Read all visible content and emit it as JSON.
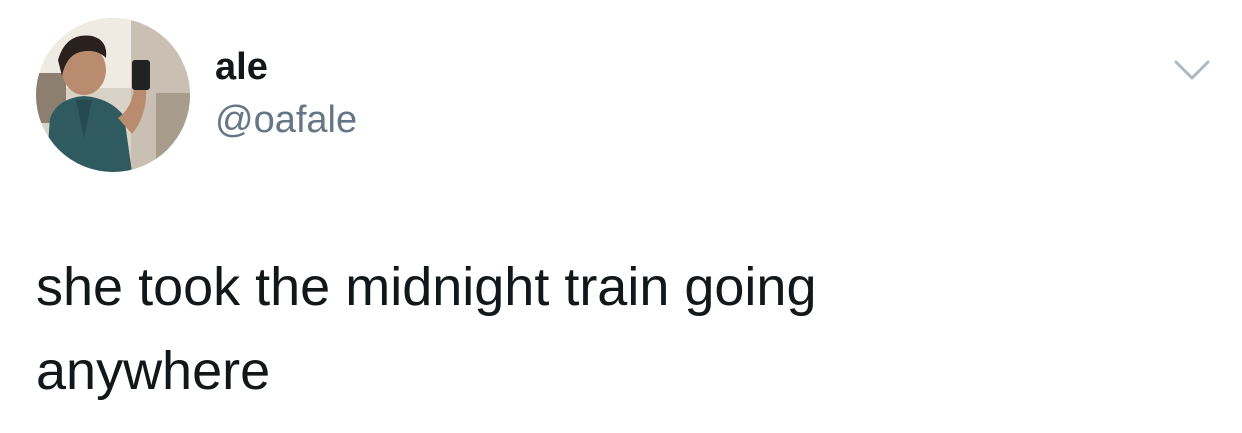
{
  "author": {
    "display_name": "ale",
    "handle": "@oafale"
  },
  "tweet": {
    "text": "she took the midnight train going\nanywhere"
  },
  "icons": {
    "avatar": "profile-photo",
    "menu": "chevron-down-icon"
  },
  "colors": {
    "text": "#14171a",
    "secondary": "#657786",
    "chevron": "#aab8c2"
  }
}
